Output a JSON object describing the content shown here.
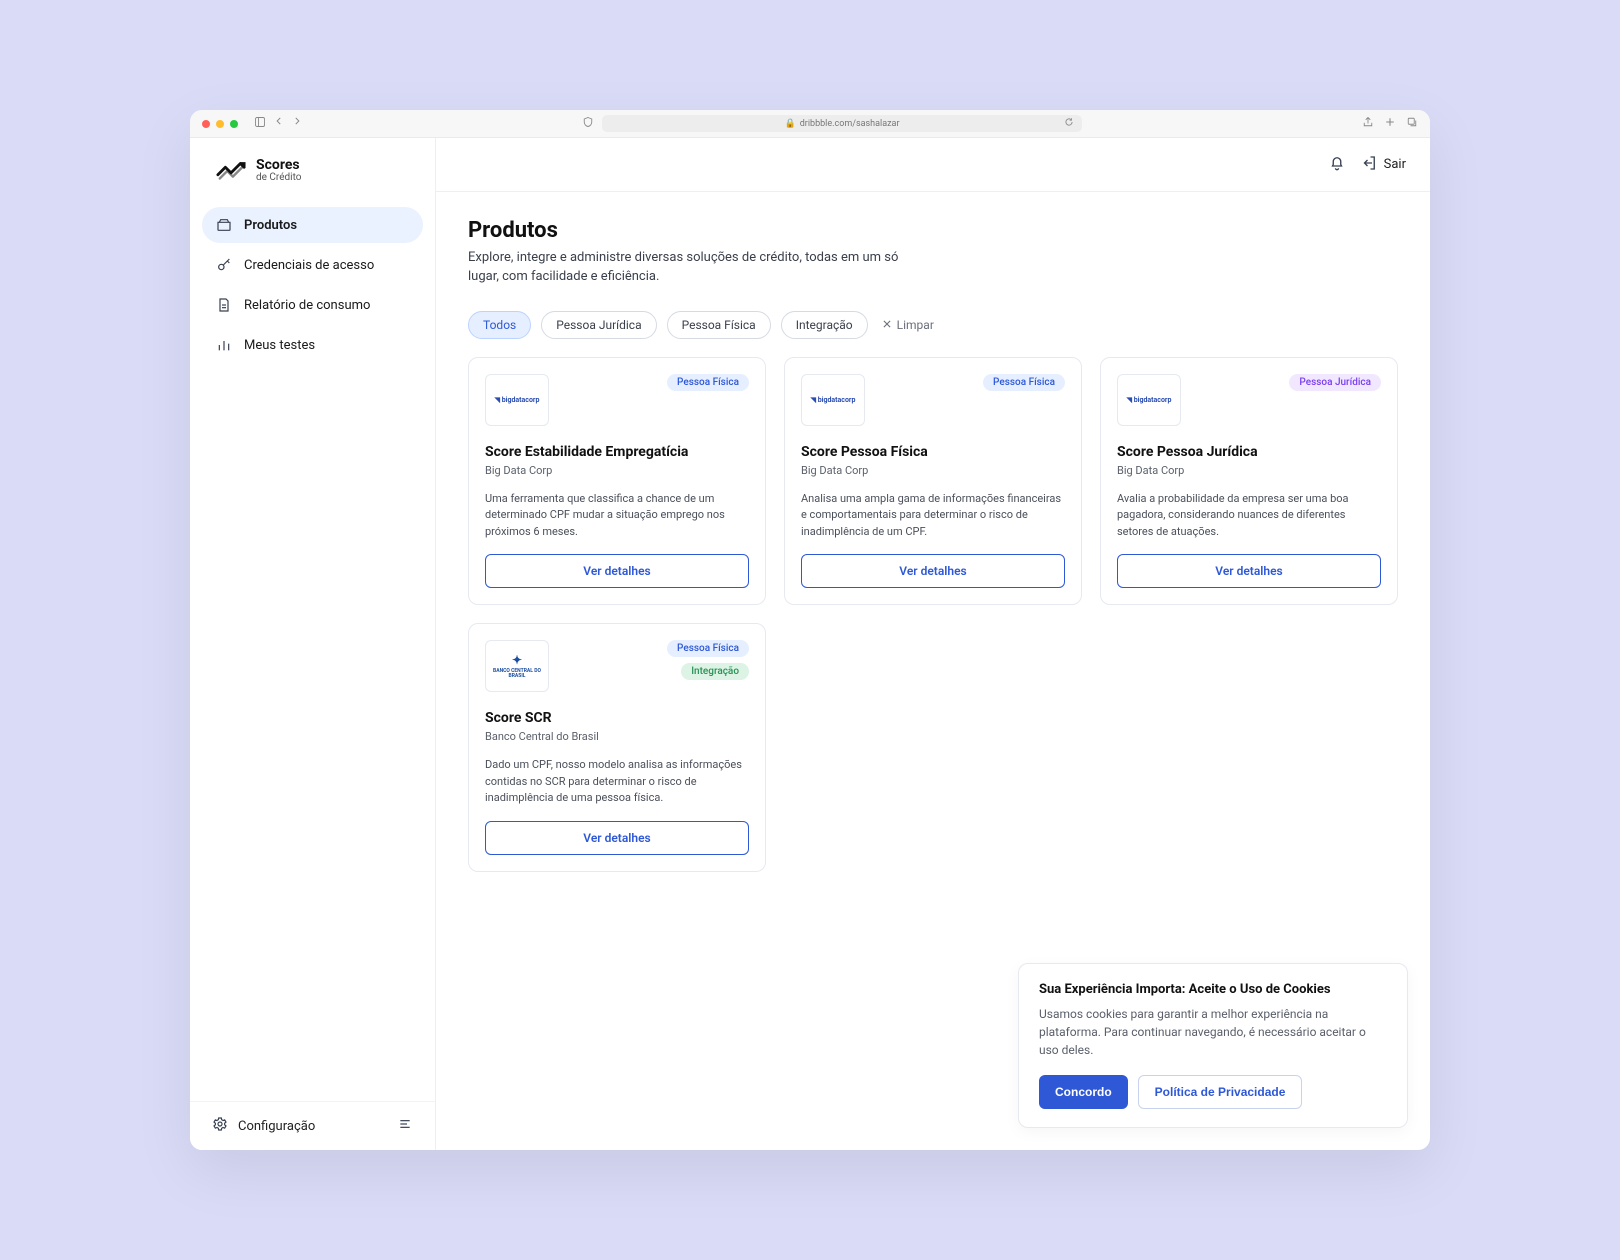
{
  "browser": {
    "url": "dribbble.com/sashalazar"
  },
  "brand": {
    "title": "Scores",
    "subtitle": "de Crédito"
  },
  "sidebar": {
    "items": [
      {
        "label": "Produtos"
      },
      {
        "label": "Credenciais de acesso"
      },
      {
        "label": "Relatório de consumo"
      },
      {
        "label": "Meus testes"
      }
    ],
    "config_label": "Configuração"
  },
  "topbar": {
    "logout_label": "Sair"
  },
  "page": {
    "title": "Produtos",
    "subtitle": "Explore, integre e administre diversas soluções de crédito, todas em um só lugar, com facilidade e eficiência."
  },
  "filters": {
    "items": [
      {
        "label": "Todos",
        "active": true
      },
      {
        "label": "Pessoa Jurídica",
        "active": false
      },
      {
        "label": "Pessoa Física",
        "active": false
      },
      {
        "label": "Integração",
        "active": false
      }
    ],
    "clear_label": "Limpar"
  },
  "badges": {
    "pf": "Pessoa Física",
    "pj": "Pessoa Jurídica",
    "int": "Integração"
  },
  "vendor_logos": {
    "bigdata": "bigdatacorp",
    "bcb": "BANCO CENTRAL DO BRASIL"
  },
  "cards": [
    {
      "title": "Score Estabilidade Empregatícia",
      "vendor": "Big Data Corp",
      "desc": "Uma ferramenta que classifica a chance de um determinado CPF mudar a situação emprego nos próximos 6 meses.",
      "btn": "Ver detalhes"
    },
    {
      "title": "Score Pessoa Física",
      "vendor": "Big Data Corp",
      "desc": "Analisa uma ampla gama de informações financeiras e comportamentais para determinar o risco de inadimplência de um CPF.",
      "btn": "Ver detalhes"
    },
    {
      "title": "Score Pessoa Jurídica",
      "vendor": "Big Data Corp",
      "desc": "Avalia a probabilidade da empresa ser uma boa pagadora, considerando nuances de diferentes setores de atuações.",
      "btn": "Ver detalhes"
    },
    {
      "title": "Score SCR",
      "vendor": "Banco Central do Brasil",
      "desc": "Dado um CPF, nosso modelo analisa as informações contidas no SCR para determinar o risco de inadimplência de uma pessoa física.",
      "btn": "Ver detalhes"
    }
  ],
  "cookie": {
    "title": "Sua Experiência Importa: Aceite o Uso de Cookies",
    "text": "Usamos cookies para garantir a melhor experiência na plataforma. Para continuar navegando, é necessário aceitar o uso deles.",
    "agree": "Concordo",
    "policy": "Política de Privacidade"
  }
}
